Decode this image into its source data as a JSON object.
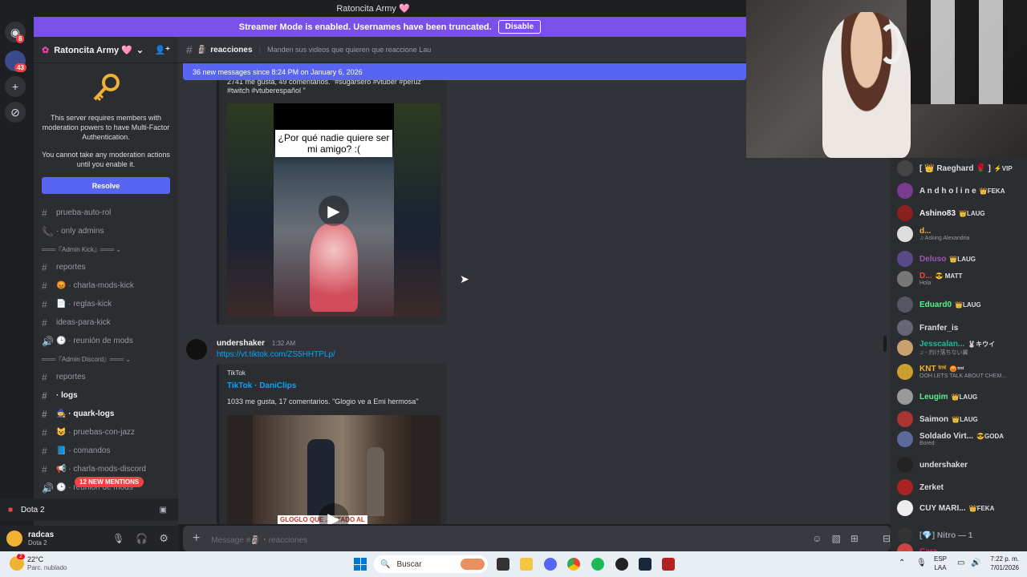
{
  "window": {
    "title": "Ratoncita Army 🩷"
  },
  "rail": {
    "badge_1": "8",
    "badge_2": "43"
  },
  "banner": {
    "text": "Streamer Mode is enabled. Usernames have been truncated.",
    "button": "Disable"
  },
  "server": {
    "name": "Ratoncita Army 🩷"
  },
  "mfa": {
    "line1": "This server requires members with moderation powers to have Multi-Factor Authentication.",
    "line2": "You cannot take any moderation actions until you enable it.",
    "resolve": "Resolve"
  },
  "channels": [
    {
      "sym": "#",
      "label": "prueba-auto-rol"
    },
    {
      "sym": "📞",
      "label": "· only admins"
    },
    {
      "cat": "═══『Admin Kick』═══ ⌄"
    },
    {
      "sym": "#",
      "label": "reportes"
    },
    {
      "sym": "#",
      "label": "😡 · charla-mods-kick"
    },
    {
      "sym": "#",
      "label": "📄 · reglas-kick"
    },
    {
      "sym": "#",
      "label": "ideas-para-kick"
    },
    {
      "sym": "🔊",
      "label": "🕒 · reunión de mods"
    },
    {
      "cat": "═══『Admin Discord』═══ ⌄"
    },
    {
      "sym": "#",
      "label": "reportes"
    },
    {
      "sym": "#",
      "label": "· logs",
      "bold": true
    },
    {
      "sym": "#",
      "label": "🧙 · quark-logs",
      "bold": true
    },
    {
      "sym": "#",
      "label": "😺 · pruebas-con-jazz"
    },
    {
      "sym": "#",
      "label": "📘 · comandos"
    },
    {
      "sym": "#",
      "label": "📢 · charla-mods-discord"
    },
    {
      "sym": "🔊",
      "label": "🕒 · reunión de mods"
    }
  ],
  "mentions": "12 NEW MENTIONS",
  "voice": {
    "game": "Dota 2"
  },
  "user": {
    "name": "radcas",
    "status": "Dota 2"
  },
  "channel": {
    "name": "reacciones",
    "topic": "Manden sus videos que quieren que reaccione Lau"
  },
  "new_messages": "36 new messages since 8:24 PM on January 6, 2026",
  "msg1": {
    "meta": "2741 me gusta, 49 comentarios. \"#sugarsero #vtuber #perúz\"",
    "tags": "#twitch #vtuberespañol \"",
    "thumb_text": "¿Por qué nadie quiere ser mi amigo? :("
  },
  "msg2": {
    "author": "undershaker",
    "time": "1:32 AM",
    "link": "https://vt.tiktok.com/ZS5HHTPLp/",
    "provider": "TikTok",
    "title": "TikTok · DaniClips",
    "desc": "1033 me gusta, 17 comentarios. \"Glogio ve a Emi hermosa\"",
    "thumb_text": "GLOGLO QUE ... CTADO AL"
  },
  "composer": {
    "placeholder": "Message #🗿・reacciones"
  },
  "members": [
    {
      "name": "[ 👑 Raeghard 🌹 ]",
      "tag": "⚡VIP",
      "color": "#dbdee1"
    },
    {
      "name": "A n d h o l i n e",
      "tag": "👑FEKA",
      "color": "#dbdee1"
    },
    {
      "name": "Ashino83",
      "tag": "👑LAUG",
      "color": "#f2f3f5"
    },
    {
      "name": "d...",
      "tag": "",
      "sub": "♫ Asking Alexandria",
      "color": "#f0b232"
    },
    {
      "name": "Deluso",
      "tag": "👑LAUG",
      "color": "#9b59b6"
    },
    {
      "name": "D...",
      "tag": "😎 MATT",
      "sub": "Hola",
      "color": "#e74c3c"
    },
    {
      "name": "Eduard0",
      "tag": "👑LAUG",
      "color": "#57f287"
    },
    {
      "name": "Franfer_is",
      "tag": "",
      "color": "#dbdee1"
    },
    {
      "name": "Jesscalan...",
      "tag": "🐰キウイ",
      "sub": "♫ - 灼け落ちない翼",
      "color": "#1abc9c"
    },
    {
      "name": "KNT ᵗᵐᵗ",
      "tag": "😡ᵗᵐᵗ",
      "sub": "OOH LETS TALK ABOUT CHEM...",
      "color": "#f0b232"
    },
    {
      "name": "Leugim",
      "tag": "👑LAUG",
      "color": "#57f287"
    },
    {
      "name": "Saimon",
      "tag": "👑LAUG",
      "color": "#dbdee1"
    },
    {
      "name": "Soldado Virt...",
      "tag": "😎GODA",
      "sub": "Bored",
      "color": "#dbdee1"
    },
    {
      "name": "undershaker",
      "tag": "",
      "color": "#dbdee1"
    },
    {
      "name": "Zerket",
      "tag": "",
      "color": "#dbdee1"
    },
    {
      "name": "CUY MARI...",
      "tag": "👑FEKA",
      "color": "#dbdee1"
    },
    {
      "name": "[💎] Nitro — 1",
      "tag": "",
      "color": "#949ba4"
    },
    {
      "name": "Cara",
      "tag": "",
      "color": "#e91e63"
    }
  ],
  "taskbar": {
    "weather_badge": "2",
    "temp": "22°C",
    "cond": "Parc. nublado",
    "search": "Buscar",
    "lang1": "ESP",
    "lang2": "LAA",
    "time": "7:22 p. m.",
    "date": "7/01/2026"
  }
}
